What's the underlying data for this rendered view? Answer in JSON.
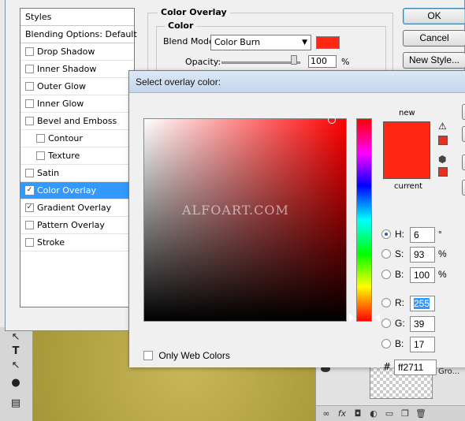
{
  "layer_style": {
    "styles_header": "Styles",
    "styles": [
      {
        "label": "Blending Options: Default",
        "type": "head"
      },
      {
        "label": "Drop Shadow",
        "checked": false
      },
      {
        "label": "Inner Shadow",
        "checked": false
      },
      {
        "label": "Outer Glow",
        "checked": false
      },
      {
        "label": "Inner Glow",
        "checked": false
      },
      {
        "label": "Bevel and Emboss",
        "checked": false
      },
      {
        "label": "Contour",
        "checked": false,
        "sub": true
      },
      {
        "label": "Texture",
        "checked": false,
        "sub": true
      },
      {
        "label": "Satin",
        "checked": false
      },
      {
        "label": "Color Overlay",
        "checked": true,
        "selected": true
      },
      {
        "label": "Gradient Overlay",
        "checked": true
      },
      {
        "label": "Pattern Overlay",
        "checked": false
      },
      {
        "label": "Stroke",
        "checked": false
      }
    ],
    "group_title": "Color Overlay",
    "inner_title": "Color",
    "blend_mode_label": "Blend Mode:",
    "blend_mode_value": "Color Burn",
    "overlay_color": "#ff2711",
    "opacity_label": "Opacity:",
    "opacity_value": "100",
    "opacity_unit": "%",
    "buttons": {
      "ok": "OK",
      "cancel": "Cancel",
      "new_style": "New Style..."
    }
  },
  "picker": {
    "title": "Select overlay color:",
    "watermark": "ALFOART.COM",
    "new_label": "new",
    "current_label": "current",
    "new_color": "#ff2711",
    "current_color": "#ff2711",
    "gamut_color": "#e8301c",
    "web_color": "#e8301c",
    "fields": [
      {
        "label": "H:",
        "value": "6",
        "unit": "°",
        "selected": true
      },
      {
        "label": "S:",
        "value": "93",
        "unit": "%",
        "selected": false
      },
      {
        "label": "B:",
        "value": "100",
        "unit": "%",
        "selected": false
      },
      {
        "label": "R:",
        "value": "255",
        "unit": "",
        "selected": false,
        "highlight": true
      },
      {
        "label": "G:",
        "value": "39",
        "unit": "",
        "selected": false
      },
      {
        "label": "B:",
        "value": "17",
        "unit": "",
        "selected": false
      }
    ],
    "hex_label": "#",
    "hex_value": "ff2711",
    "only_web_colors": "Only Web Colors"
  },
  "layers": {
    "layer_name": "Gro..."
  },
  "icons": [
    "type-tool-icon",
    "path-select-icon",
    "ellipse-tool-icon",
    "notes-tool-icon",
    "link-icon",
    "fx-icon",
    "mask-icon",
    "adjustment-icon",
    "folder-icon",
    "new-layer-icon",
    "trash-icon",
    "warning-icon",
    "cube-icon"
  ]
}
